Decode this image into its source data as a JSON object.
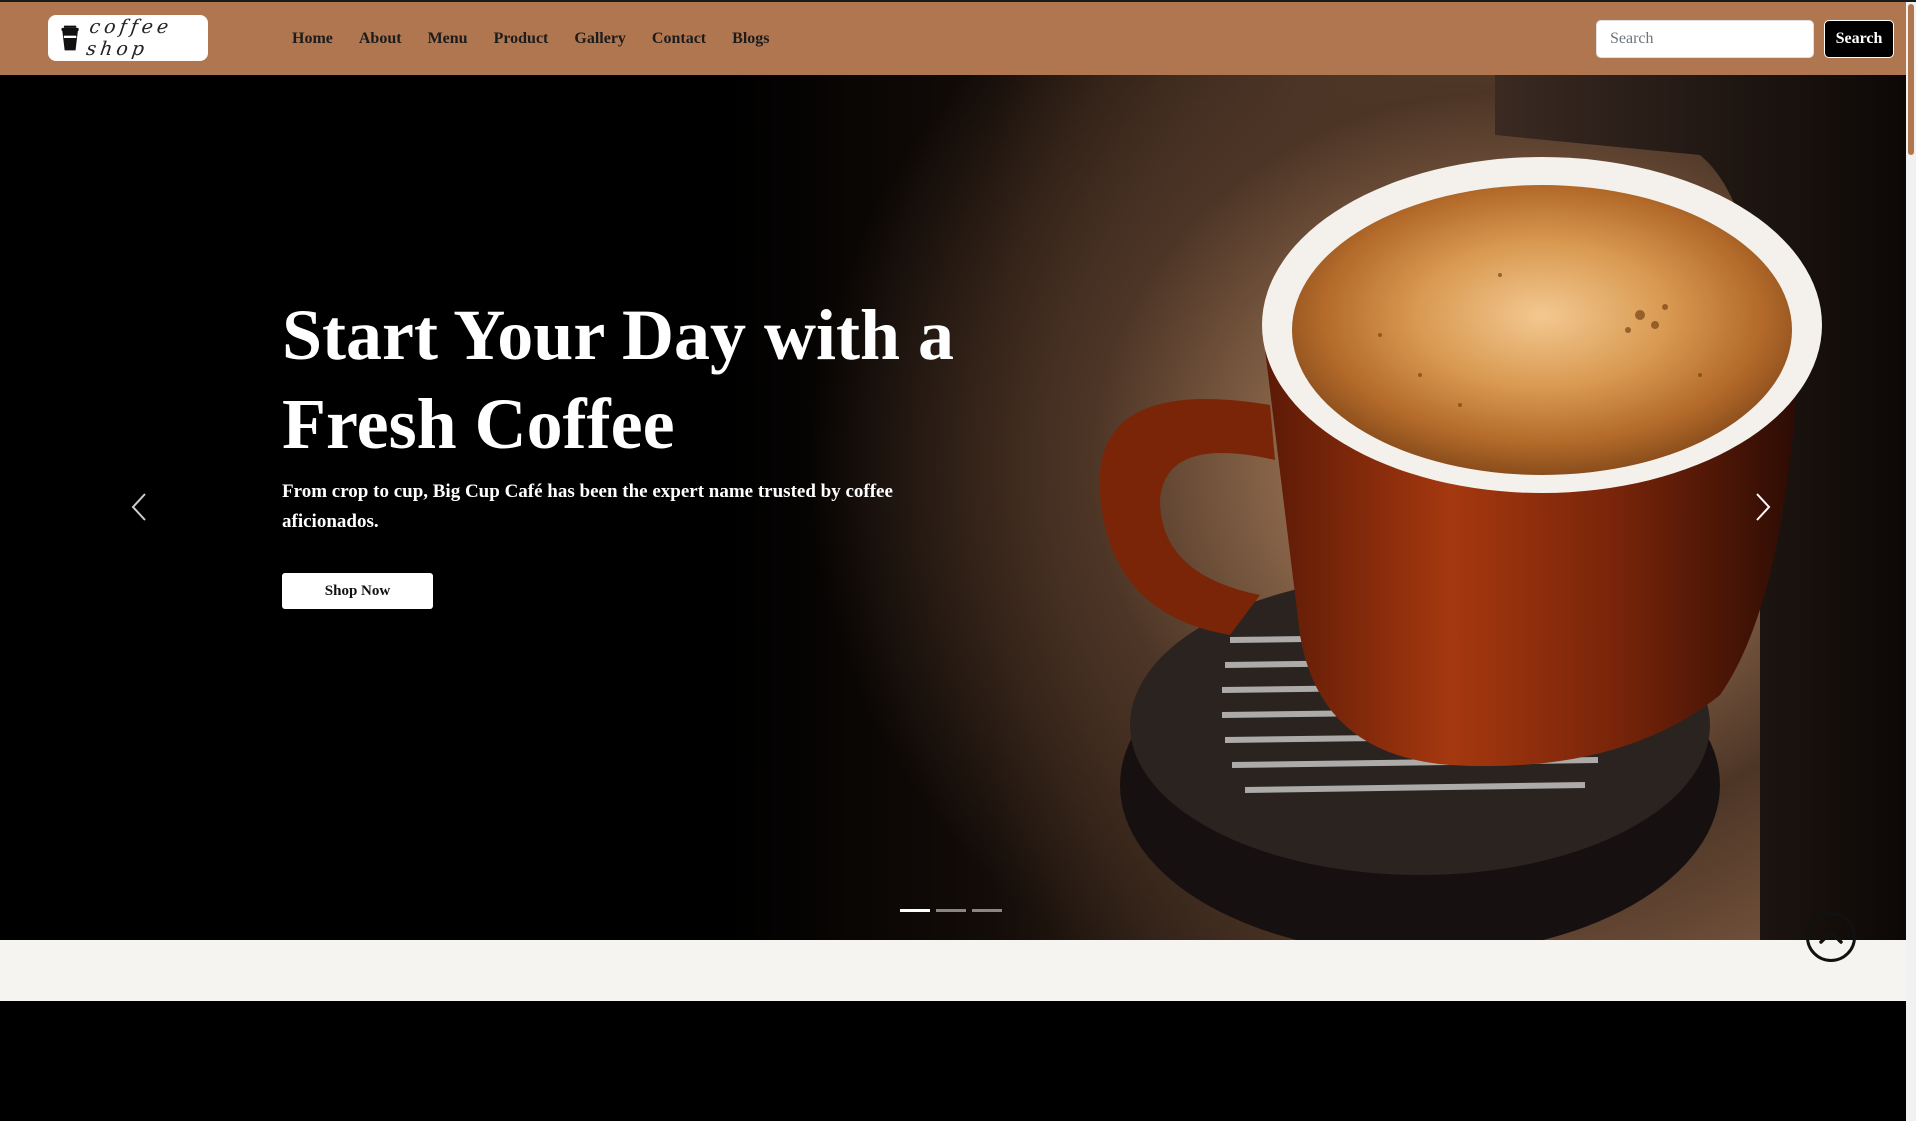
{
  "brand": {
    "logo_text": "coffee shop",
    "icon": "coffee-cup-icon"
  },
  "nav": {
    "items": [
      {
        "label": "Home"
      },
      {
        "label": "About"
      },
      {
        "label": "Menu"
      },
      {
        "label": "Product"
      },
      {
        "label": "Gallery"
      },
      {
        "label": "Contact"
      },
      {
        "label": "Blogs"
      }
    ]
  },
  "search": {
    "placeholder": "Search",
    "value": "",
    "button_label": "Search"
  },
  "hero": {
    "title": "Start Your Day with a Fresh Coffee",
    "subtitle": "From crop to cup, Big Cup Café has been the expert name trusted by coffee aficionados.",
    "cta_label": "Shop Now",
    "prev_icon": "chevron-left-icon",
    "next_icon": "chevron-right-icon",
    "slides_count": 3,
    "active_slide": 1
  },
  "scroll_top": {
    "icon": "chevron-up-circle-icon"
  },
  "colors": {
    "navbar": "#b07650",
    "button_dark": "#000000",
    "hero_text": "#ffffff",
    "band_light": "#f6f4f1"
  }
}
